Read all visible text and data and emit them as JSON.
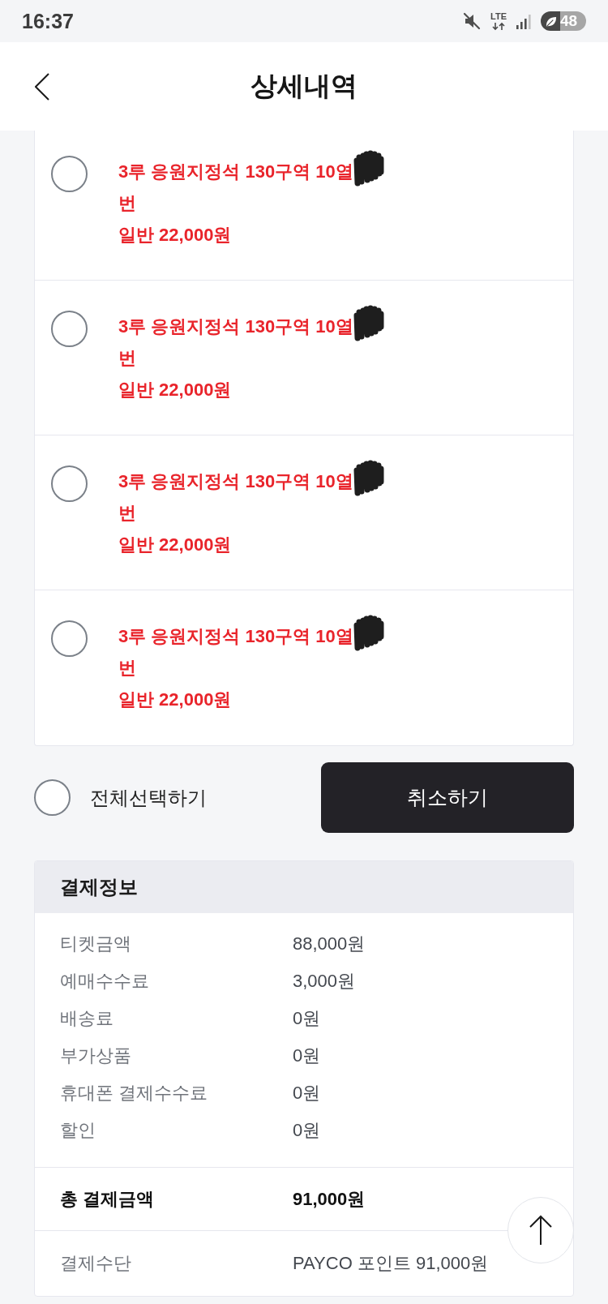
{
  "status_bar": {
    "time": "16:37",
    "network": "LTE",
    "battery": "48"
  },
  "header": {
    "title": "상세내역"
  },
  "tickets": [
    {
      "seat": "3루 응원지정석 130구역 10열",
      "seat_suffix": "번",
      "price": "일반 22,000원",
      "checked": false,
      "redacted": true
    },
    {
      "seat": "3루 응원지정석 130구역 10열",
      "seat_suffix": "번",
      "price": "일반 22,000원",
      "checked": false,
      "redacted": true
    },
    {
      "seat": "3루 응원지정석 130구역 10열",
      "seat_suffix": "번",
      "price": "일반 22,000원",
      "checked": false,
      "redacted": true
    },
    {
      "seat": "3루 응원지정석 130구역 10열",
      "seat_suffix": "번",
      "price": "일반 22,000원",
      "checked": false,
      "redacted": true
    }
  ],
  "select_all": {
    "label": "전체선택하기",
    "checked": false
  },
  "cancel_button": {
    "label": "취소하기"
  },
  "payment": {
    "title": "결제정보",
    "rows": [
      {
        "label": "티켓금액",
        "value": "88,000원"
      },
      {
        "label": "예매수수료",
        "value": "3,000원"
      },
      {
        "label": "배송료",
        "value": "0원"
      },
      {
        "label": "부가상품",
        "value": "0원"
      },
      {
        "label": "휴대폰 결제수수료",
        "value": "0원"
      },
      {
        "label": "할인",
        "value": "0원"
      }
    ],
    "total": {
      "label": "총 결제금액",
      "value": "91,000원"
    },
    "method": {
      "label": "결제수단",
      "value": "PAYCO 포인트 91,000원"
    }
  }
}
